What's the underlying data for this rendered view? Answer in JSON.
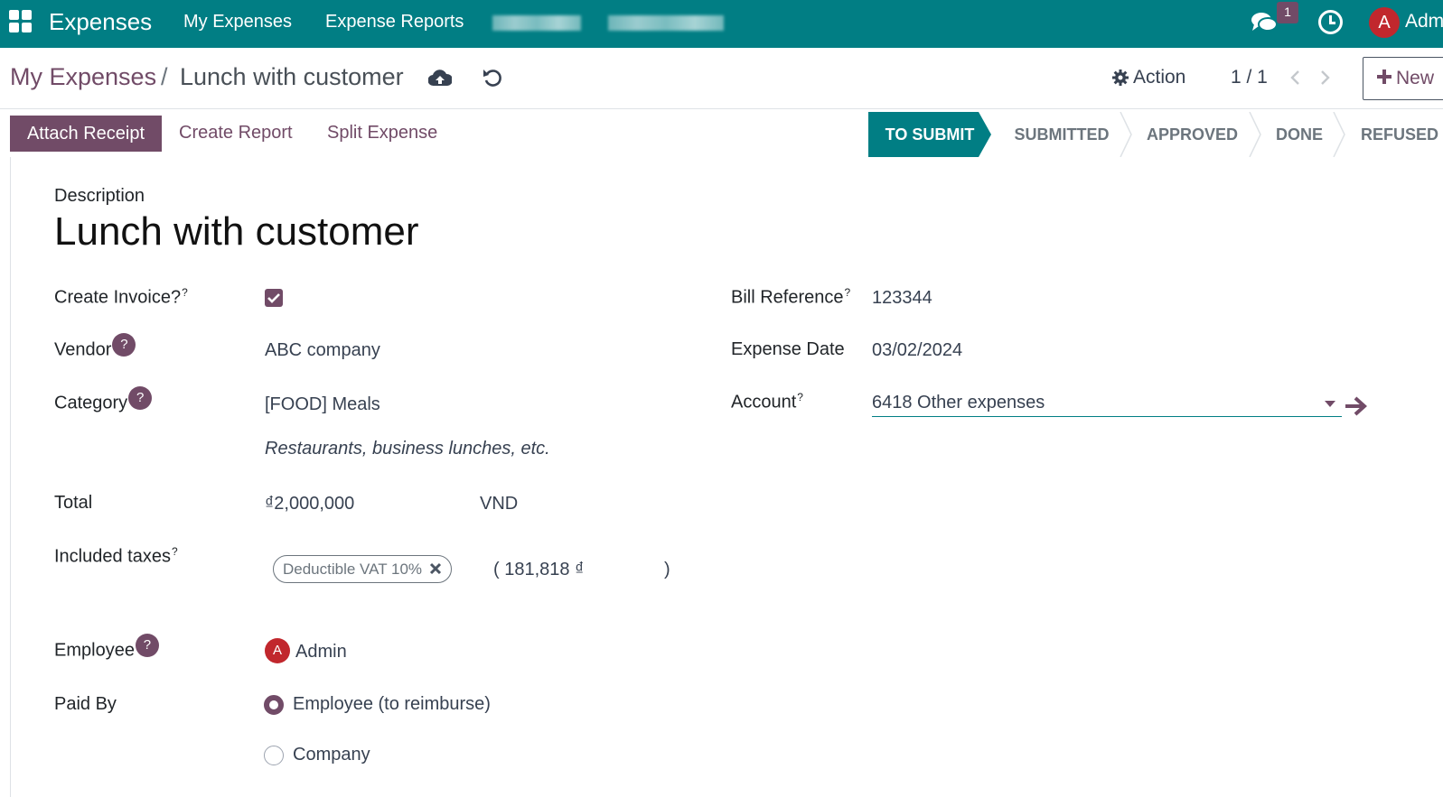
{
  "nav": {
    "app_name": "Expenses",
    "menu": [
      "My Expenses",
      "Expense Reports"
    ],
    "messages_count": "1",
    "user_initial": "A",
    "user_name": "Adm"
  },
  "control": {
    "breadcrumb_parent": "My Expenses",
    "breadcrumb_sep": "/",
    "breadcrumb_current": "Lunch with customer",
    "action_label": "Action",
    "pager": "1 / 1",
    "new_label": "New"
  },
  "statusbar": {
    "attach_receipt": "Attach Receipt",
    "create_report": "Create Report",
    "split_expense": "Split Expense",
    "stages": [
      "TO SUBMIT",
      "SUBMITTED",
      "APPROVED",
      "DONE",
      "REFUSED"
    ],
    "active_stage": "TO SUBMIT"
  },
  "form": {
    "description_label": "Description",
    "title": "Lunch with customer",
    "create_invoice_label": "Create Invoice?",
    "create_invoice_checked": true,
    "vendor_label": "Vendor",
    "vendor_value": "ABC company",
    "category_label": "Category",
    "category_value": "[FOOD] Meals",
    "category_note": "Restaurants, business lunches, etc.",
    "total_label": "Total",
    "total_value": "₫2,000,000",
    "currency": "VND",
    "included_taxes_label": "Included taxes",
    "tax_tag": "Deductible VAT 10%",
    "tax_amount": "( 181,818 ₫",
    "tax_close": ")",
    "employee_label": "Employee",
    "employee_initial": "A",
    "employee_value": "Admin",
    "paid_by_label": "Paid By",
    "paid_by_options": [
      "Employee (to reimburse)",
      "Company"
    ],
    "paid_by_selected": "Employee (to reimburse)",
    "bill_reference_label": "Bill Reference",
    "bill_reference_value": "123344",
    "expense_date_label": "Expense Date",
    "expense_date_value": "03/02/2024",
    "account_label": "Account",
    "account_value": "6418 Other expenses",
    "help_mark": "?",
    "sup_mark": "?"
  },
  "colors": {
    "navbar": "#017e84",
    "brand_purple": "#714b67",
    "avatar_red": "#c1272d"
  }
}
